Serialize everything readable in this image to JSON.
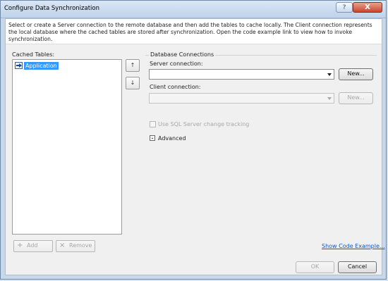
{
  "window": {
    "title": "Configure Data Synchronization",
    "help_label": "?",
    "close_label": "X"
  },
  "description": "Select or create a Server connection to the remote database and then add the tables to cache locally. The Client connection represents the local database where the cached tables are stored after synchronization. Open the code example link to view how to invoke synchronization.",
  "cached_tables": {
    "label": "Cached Tables:",
    "items": [
      {
        "label": "Application",
        "icon": "table-icon"
      }
    ]
  },
  "move_buttons": {
    "up": "↑",
    "down": "↓"
  },
  "database_connections": {
    "title": "Database Connections",
    "server_label": "Server connection:",
    "server_value": "",
    "server_new_label": "New...",
    "client_label": "Client connection:",
    "client_value": "",
    "client_new_label": "New..."
  },
  "options": {
    "use_sql_change_tracking": "Use SQL Server change tracking",
    "advanced": "Advanced",
    "advanced_icon": "chevron-double-down-icon"
  },
  "actions": {
    "add": "Add",
    "remove": "Remove",
    "show_code_example": "Show Code Example...",
    "ok": "OK",
    "cancel": "Cancel"
  }
}
